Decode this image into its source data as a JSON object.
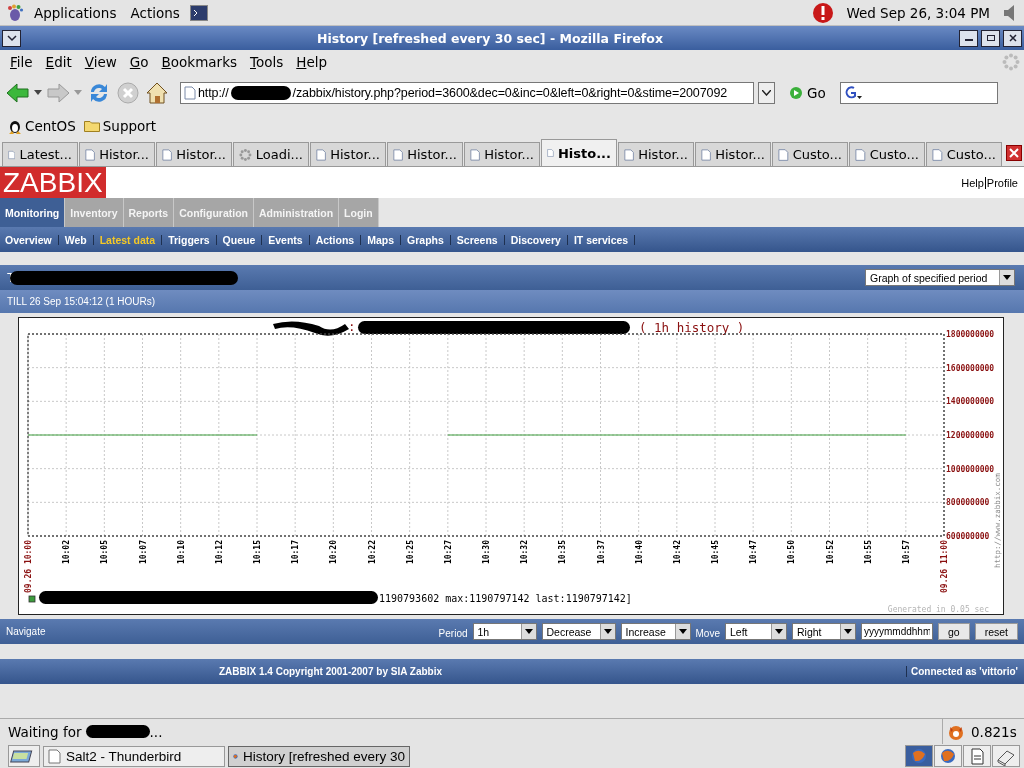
{
  "desktop_panel": {
    "menus": [
      "Applications",
      "Actions"
    ],
    "clock": "Wed Sep 26,  3:04 PM"
  },
  "window": {
    "title": "History [refreshed every 30 sec] - Mozilla Firefox"
  },
  "menu_bar": [
    "File",
    "Edit",
    "View",
    "Go",
    "Bookmarks",
    "Tools",
    "Help"
  ],
  "address_bar": {
    "prefix": "http://",
    "value": "/zabbix/history.php?period=3600&dec=0&inc=0&left=0&right=0&stime=2007092",
    "go": "Go"
  },
  "bookmarks": [
    {
      "label": "CentOS",
      "kind": "site"
    },
    {
      "label": "Support",
      "kind": "folder"
    }
  ],
  "tabs": [
    {
      "label": "Latest...",
      "selected": false,
      "loading": false
    },
    {
      "label": "Histor...",
      "selected": false,
      "loading": false
    },
    {
      "label": "Histor...",
      "selected": false,
      "loading": false
    },
    {
      "label": "Loadi...",
      "selected": false,
      "loading": true
    },
    {
      "label": "Histor...",
      "selected": false,
      "loading": false
    },
    {
      "label": "Histor...",
      "selected": false,
      "loading": false
    },
    {
      "label": "Histor...",
      "selected": false,
      "loading": false
    },
    {
      "label": "Histo...",
      "selected": true,
      "loading": false
    },
    {
      "label": "Histor...",
      "selected": false,
      "loading": false
    },
    {
      "label": "Histor...",
      "selected": false,
      "loading": false
    },
    {
      "label": "Custo...",
      "selected": false,
      "loading": false
    },
    {
      "label": "Custo...",
      "selected": false,
      "loading": false
    },
    {
      "label": "Custo...",
      "selected": false,
      "loading": false
    }
  ],
  "zabbix": {
    "logo": "ZABBIX",
    "top_links": [
      "Help",
      "Profile"
    ],
    "main_menu": [
      {
        "label": "Monitoring",
        "selected": true
      },
      {
        "label": "Inventory",
        "selected": false
      },
      {
        "label": "Reports",
        "selected": false
      },
      {
        "label": "Configuration",
        "selected": false
      },
      {
        "label": "Administration",
        "selected": false
      },
      {
        "label": "Login",
        "selected": false
      }
    ],
    "sub_menu": [
      {
        "label": "Overview",
        "selected": false
      },
      {
        "label": "Web",
        "selected": false
      },
      {
        "label": "Latest data",
        "selected": true
      },
      {
        "label": "Triggers",
        "selected": false
      },
      {
        "label": "Queue",
        "selected": false
      },
      {
        "label": "Events",
        "selected": false
      },
      {
        "label": "Actions",
        "selected": false
      },
      {
        "label": "Maps",
        "selected": false
      },
      {
        "label": "Graphs",
        "selected": false
      },
      {
        "label": "Screens",
        "selected": false
      },
      {
        "label": "Discovery",
        "selected": false
      },
      {
        "label": "IT services",
        "selected": false
      }
    ],
    "host_prefix": "T",
    "graph_select": "Graph of specified period",
    "till": "TILL 26 Sep 15:04:12 (1 HOURs)",
    "chart": {
      "separator": ":",
      "legend": "1190793602 max:1190797142 last:1190797142]",
      "generated": "Generated in 0.05 sec",
      "watermark": "http://www.zabbix.com",
      "chart_data": {
        "type": "line",
        "title": "( 1h history )",
        "x": [
          "09.26 10:00",
          "10:02",
          "10:05",
          "10:07",
          "10:10",
          "10:12",
          "10:15",
          "10:17",
          "10:20",
          "10:22",
          "10:25",
          "10:27",
          "10:30",
          "10:32",
          "10:35",
          "10:37",
          "10:40",
          "10:42",
          "10:45",
          "10:47",
          "10:50",
          "10:52",
          "10:55",
          "10:57",
          "09.26 11:00"
        ],
        "yticks": [
          600000000,
          800000000,
          1000000000,
          1200000000,
          1400000000,
          1600000000,
          1800000000
        ],
        "ylim": [
          600000000,
          1800000000
        ],
        "grid": true,
        "series": [
          {
            "color": "#3c9c3c",
            "values": [
              1200000000,
              1200000000,
              1200000000,
              1200000000,
              1200000000,
              1200000000,
              1200000000,
              null,
              null,
              null,
              null,
              1200000000,
              1200000000,
              1200000000,
              1200000000,
              1200000000,
              1200000000,
              1200000000,
              1200000000,
              1200000000,
              1200000000,
              1200000000,
              1200000000,
              1200000000,
              null
            ]
          }
        ]
      }
    },
    "navigate": {
      "label": "Navigate",
      "period_label": "Period",
      "period": "1h",
      "decrease": "Decrease",
      "increase": "Increase",
      "move_label": "Move",
      "left": "Left",
      "right": "Right",
      "date": "yyyymmddhhm",
      "go": "go",
      "reset": "reset"
    },
    "footer": {
      "copyright": "ZABBIX 1.4 Copyright 2001-2007 by  SIA Zabbix",
      "connected": "Connected as 'vittorio'"
    }
  },
  "status_bar": {
    "text": "Waiting for",
    "suffix": "...",
    "time": "0.821s"
  },
  "taskbar": {
    "windows": [
      {
        "label": "Salt2 - Thunderbird",
        "selected": false
      },
      {
        "label": "History [refreshed every 30",
        "selected": true
      }
    ]
  }
}
